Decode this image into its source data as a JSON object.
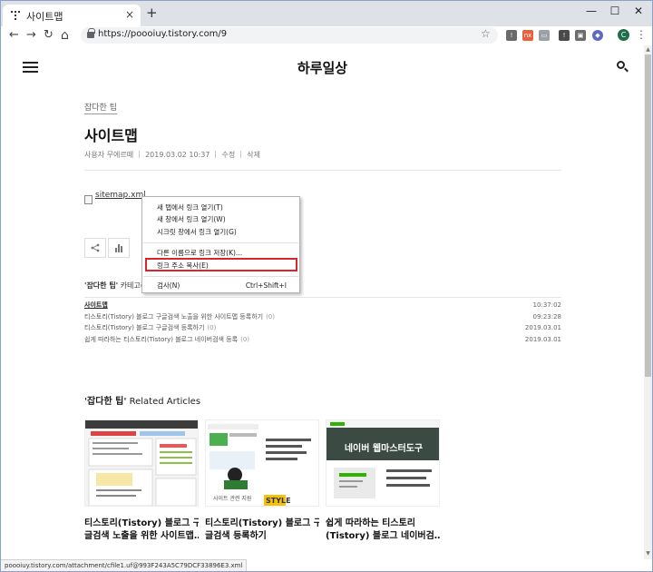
{
  "browser": {
    "tab_title": "사이트맵",
    "tab_close": "×",
    "new_tab": "+",
    "url": "https://poooiuy.tistory.com/9",
    "window_min": "—",
    "window_max": "☐",
    "window_close": "✕",
    "back": "←",
    "forward": "→",
    "reload": "↻",
    "home": "⌂",
    "star": "☆",
    "profile_initial": "C",
    "menu": "⋮",
    "extensions": [
      {
        "icon": "extension-icon",
        "label": "!",
        "color": "#6b6b6b"
      },
      {
        "icon": "extension-icon",
        "label": "nx",
        "color": "#e8603c"
      },
      {
        "icon": "extension-icon",
        "label": "▭",
        "color": "#9aa0a6"
      },
      {
        "icon": "extension-icon",
        "label": "!",
        "color": "#4a4a4a"
      },
      {
        "icon": "extension-icon",
        "label": "▣",
        "color": "#6b6b6b"
      },
      {
        "icon": "extension-icon",
        "label": "◆",
        "color": "#5c6bc0"
      }
    ]
  },
  "blog": {
    "title": "하루일상",
    "category": "잡다한 팁",
    "post_title": "사이트맵",
    "author": "사용자 무에르떼",
    "date": "2019.03.02 10:37",
    "edit": "수정",
    "delete": "삭제",
    "attachment": "sitemap.xml",
    "category_heading_name": "'잡다한 팁'",
    "category_heading_suffix": " 카테고리의",
    "category_posts": [
      {
        "title": "사이트맵",
        "count": "",
        "date": "10:37:02",
        "current": true
      },
      {
        "title": "티스토리(Tistory) 블로그 구글검색 노출을 위한 사이트맵 등록하기",
        "count": "(0)",
        "date": "09:23:28",
        "current": false
      },
      {
        "title": "티스토리(Tistory) 블로그 구글검색 등록하기",
        "count": "(0)",
        "date": "2019.03.01",
        "current": false
      },
      {
        "title": "쉽게 따라하는 티스토리(Tistory) 블로그 네이버검색 등록",
        "count": "(0)",
        "date": "2019.03.01",
        "current": false
      }
    ],
    "related_heading_name": "'잡다한 팁'",
    "related_heading_suffix": " Related Articles",
    "related": [
      {
        "line1": "티스토리(Tistory) 블로그 구",
        "line2": "글검색 노출을 위한 사이트맵…"
      },
      {
        "line1": "티스토리(Tistory) 블로그 구",
        "line2": "글검색 등록하기"
      },
      {
        "line1": "쉽게 따라하는 티스토리",
        "line2": "(Tistory) 블로그 네이버검…"
      }
    ],
    "thumb3_banner": "네이버 웹마스터도구",
    "thumb2_text": "사이트 관련 지원"
  },
  "context_menu": {
    "items": [
      {
        "label": "새 탭에서 링크 열기(T)",
        "shortcut": ""
      },
      {
        "label": "새 창에서 링크 열기(W)",
        "shortcut": ""
      },
      {
        "label": "시크릿 창에서 링크 열기(G)",
        "shortcut": ""
      },
      {
        "label": "다른 이름으로 링크 저장(K)...",
        "shortcut": ""
      },
      {
        "label": "링크 주소 복사(E)",
        "shortcut": ""
      },
      {
        "label": "검사(N)",
        "shortcut": "Ctrl+Shift+I"
      }
    ],
    "highlight_color": "#d9262c"
  },
  "status_url": "poooiuy.tistory.com/attachment/cfile1.uf@993F243A5C79DCF33896E3.xml"
}
